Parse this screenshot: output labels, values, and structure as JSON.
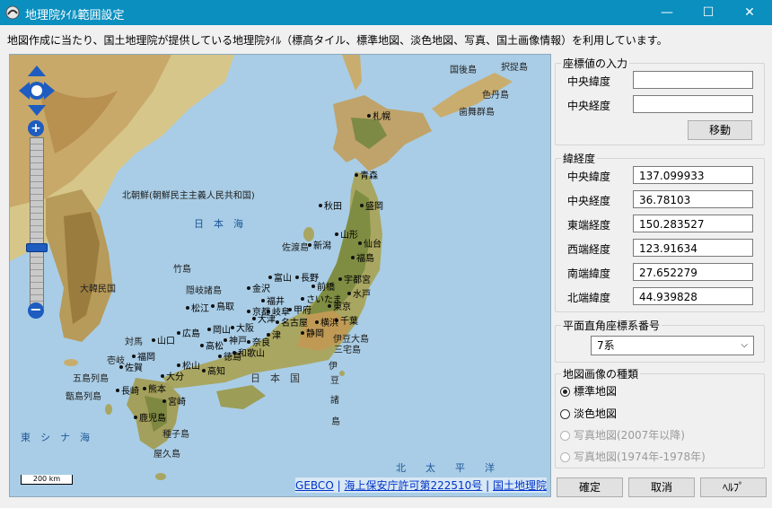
{
  "window": {
    "title": "地理院ﾀｲﾙ範囲設定",
    "minimize": "—",
    "maximize": "☐",
    "close": "✕"
  },
  "description": "地図作成に当たり、国土地理院が提供している地理院ﾀｲﾙ（標高タイル、標準地図、淡色地図、写真、国土画像情報）を利用しています。",
  "map": {
    "scale_label": "200 km",
    "sea_labels": {
      "japan_sea": "日　本　海",
      "east_china_sea": "東　シ　ナ　海",
      "pacific": "北　　太　　平　　洋",
      "japan": "日　本　国"
    },
    "places": {
      "kunashiri": "国後島",
      "etorofu": "択捉島",
      "shikotan": "色丹島",
      "habomai": "歯舞群島",
      "sapporo": "札幌",
      "aomori": "青森",
      "akita": "秋田",
      "morioka": "盛岡",
      "yamagata": "山形",
      "sendai": "仙台",
      "niigata": "新潟",
      "fukushima": "福島",
      "sado": "佐渡島",
      "utsunomiya": "宇都宮",
      "maebashi": "前橋",
      "mito": "水戸",
      "nagano": "長野",
      "toyama": "富山",
      "kanazawa": "金沢",
      "fukui": "福井",
      "saitama": "さいたま",
      "tokyo": "東京",
      "chiba": "千葉",
      "kofu": "甲府",
      "gifu": "岐阜",
      "kyoto": "京都",
      "otsu": "大津",
      "nagoya": "名古屋",
      "yokohama": "横浜",
      "shizuoka": "静岡",
      "tsu": "津",
      "nara": "奈良",
      "osaka": "大阪",
      "kobe": "神戸",
      "wakayama": "和歌山",
      "oki": "隠岐諸島",
      "takeshima": "竹島",
      "matsue": "松江",
      "tottori": "鳥取",
      "okayama": "岡山",
      "hiroshima": "広島",
      "yamaguchi": "山口",
      "takamatsu": "高松",
      "tokushima": "徳島",
      "matsuyama": "松山",
      "kochi": "高知",
      "fukuoka": "福岡",
      "saga": "佐賀",
      "nagasaki": "長崎",
      "kumamoto": "熊本",
      "oita": "大分",
      "miyazaki": "宮崎",
      "kagoshima": "鹿児島",
      "tsushima": "対馬",
      "iki": "壱岐",
      "goto": "五島列島",
      "koshiki": "甑島列島",
      "tanegashima": "種子島",
      "yakushima": "屋久島",
      "izu_oshima": "伊豆大島",
      "miyake": "三宅島",
      "izu": "伊",
      "zu": "豆",
      "sho": "諸",
      "to": "島",
      "north_korea": "北朝鮮(朝鮮民主主義人民共和国)",
      "south_korea": "大韓民国"
    },
    "attribution": {
      "gebco": "GEBCO",
      "sep1": "|",
      "permit": "海上保安庁許可第222510号",
      "sep2": "|",
      "gsi": "国土地理院"
    }
  },
  "coord_input": {
    "legend": "座標値の入力",
    "lat_label": "中央緯度",
    "lat_value": "",
    "lon_label": "中央経度",
    "lon_value": "",
    "move_button": "移動"
  },
  "latlon": {
    "legend": "緯経度",
    "rows": [
      {
        "label": "中央緯度",
        "value": "137.099933"
      },
      {
        "label": "中央経度",
        "value": "36.78103"
      },
      {
        "label": "東端経度",
        "value": "150.283527"
      },
      {
        "label": "西端経度",
        "value": "123.91634"
      },
      {
        "label": "南端緯度",
        "value": "27.652279"
      },
      {
        "label": "北端緯度",
        "value": "44.939828"
      }
    ]
  },
  "plane_coord": {
    "legend": "平面直角座標系番号",
    "selected": "7系"
  },
  "map_type": {
    "legend": "地図画像の種類",
    "options": [
      {
        "label": "標準地図",
        "checked": true,
        "enabled": true
      },
      {
        "label": "淡色地図",
        "checked": false,
        "enabled": true
      },
      {
        "label": "写真地図(2007年以降)",
        "checked": false,
        "enabled": false
      },
      {
        "label": "写真地図(1974年-1978年)",
        "checked": false,
        "enabled": false
      }
    ]
  },
  "buttons": {
    "ok": "確定",
    "cancel": "取消",
    "help": "ﾍﾙﾌﾟ"
  }
}
